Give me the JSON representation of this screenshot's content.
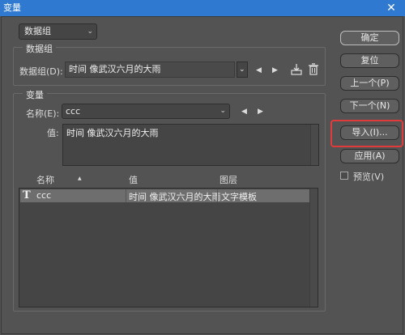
{
  "window": {
    "title": "变量",
    "close_glyph": "✕"
  },
  "top_dropdown": {
    "value": "数据组"
  },
  "dataset_group": {
    "title": "数据组",
    "label": "数据组(D):",
    "value": "时间 像武汉六月的大雨"
  },
  "variable_group": {
    "title": "变量",
    "name_label": "名称(E):",
    "name_value": "ccc",
    "value_label": "值:",
    "value_text": "时间 像武汉六月的大雨"
  },
  "table": {
    "headers": [
      "名称",
      "值",
      "图层"
    ],
    "sort_glyph": "▲",
    "rows": [
      {
        "type_glyph": "T",
        "name": "ccc",
        "value": "时间 像武汉六月的大雨",
        "layer": "文字模板"
      }
    ]
  },
  "buttons": {
    "ok": "确定",
    "reset": "复位",
    "prev": "上一个(P)",
    "next": "下一个(N)",
    "import": "导入(I)...",
    "apply": "应用(A)"
  },
  "preview": {
    "label": "预览(V)",
    "checked": false
  },
  "glyphs": {
    "chevron": "⌄",
    "left": "◀",
    "right": "▶"
  },
  "colors": {
    "titlebar": "#2f79d0",
    "highlight": "#e03a3a",
    "panel": "#535353"
  }
}
